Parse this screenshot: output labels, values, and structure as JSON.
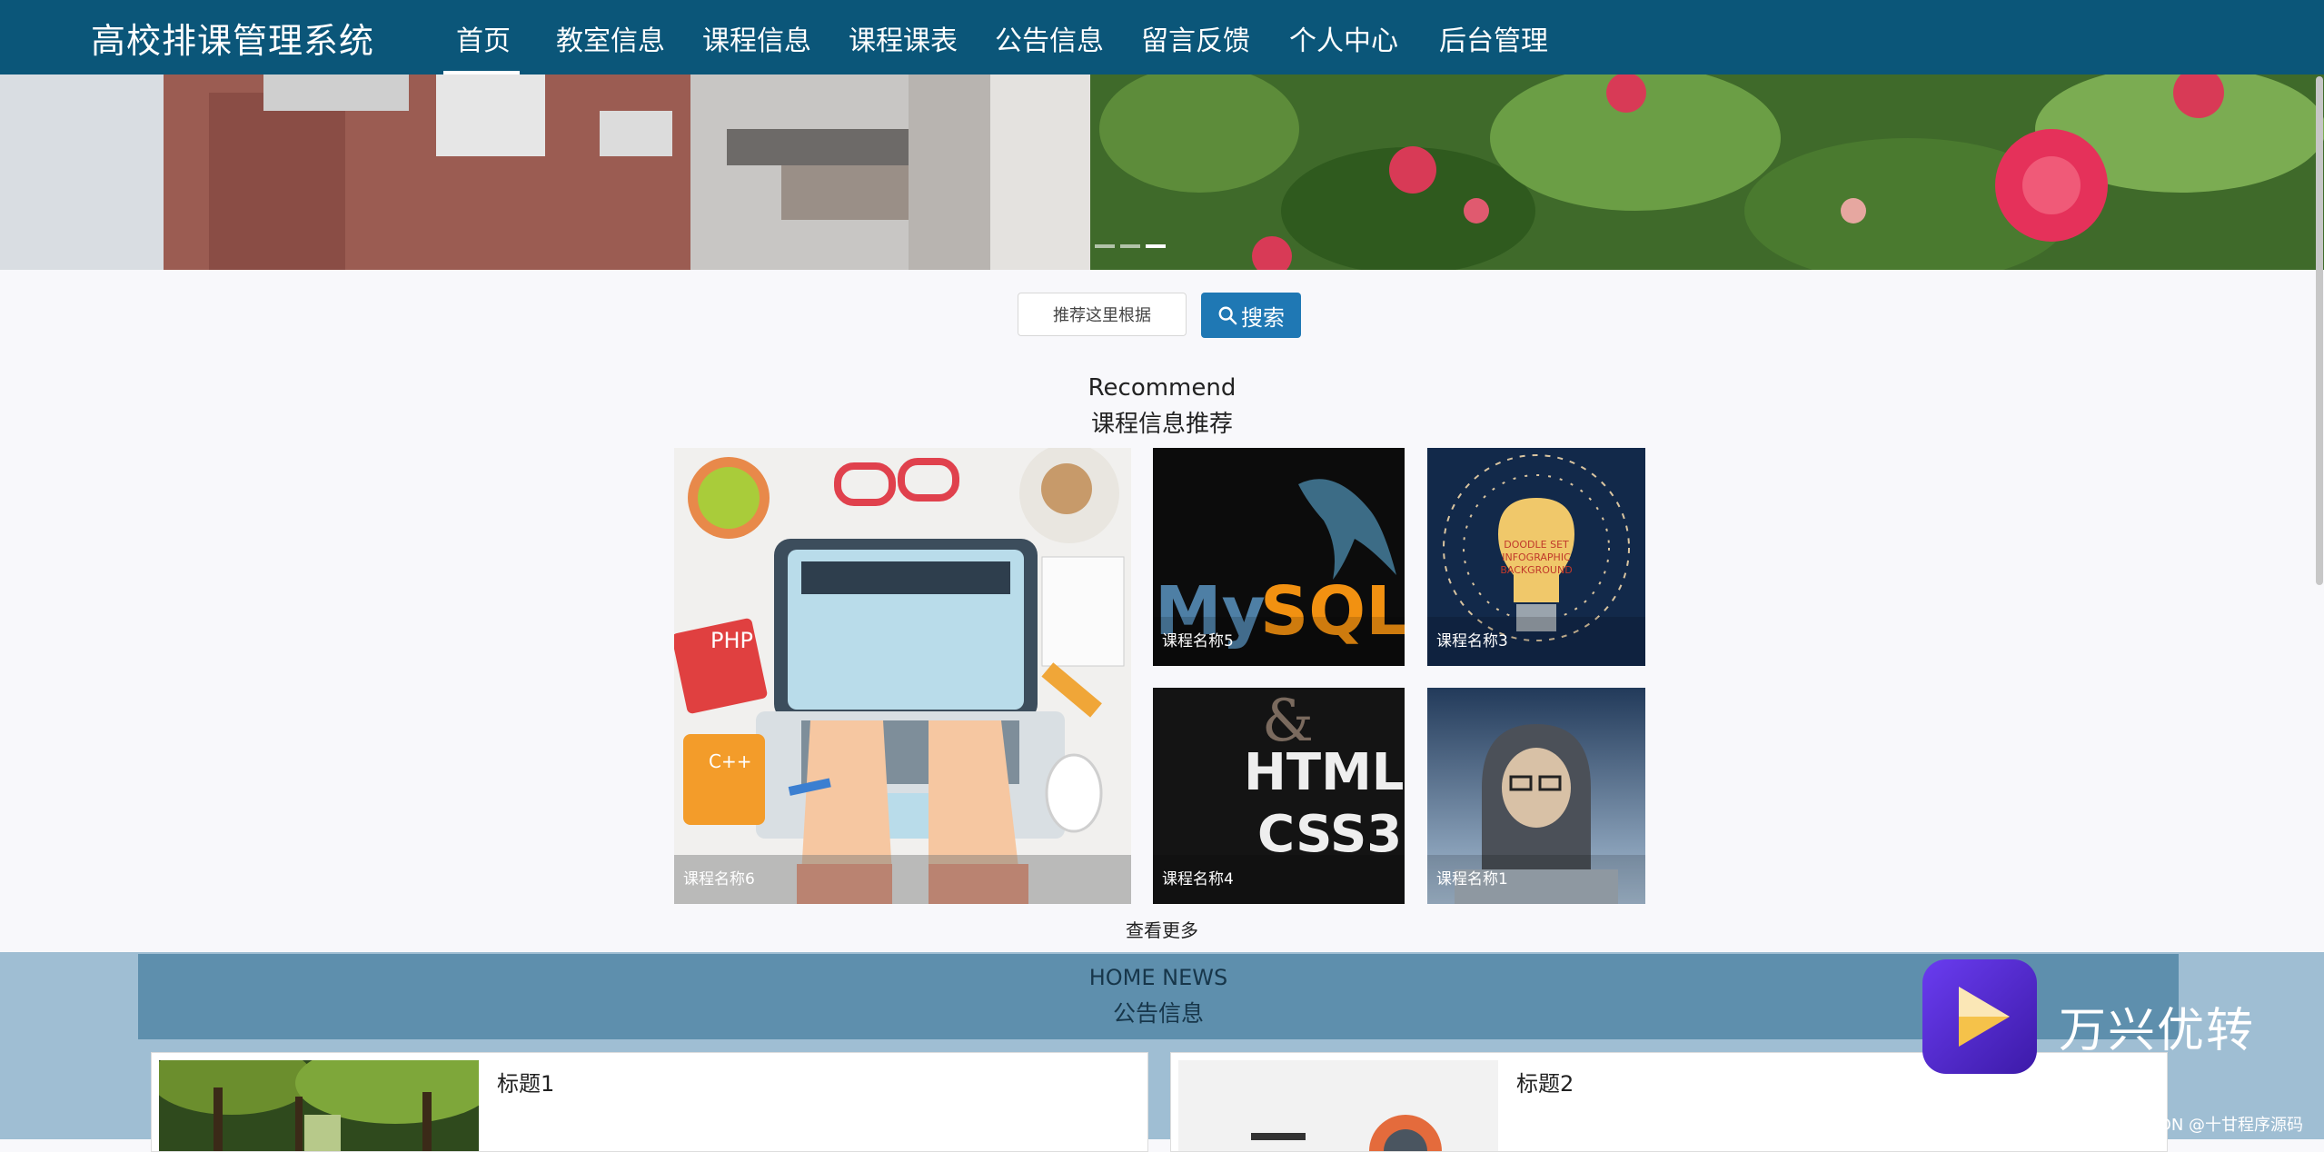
{
  "app": {
    "title": "高校排课管理系统"
  },
  "nav": {
    "items": [
      {
        "label": "首页",
        "active": true
      },
      {
        "label": "教室信息"
      },
      {
        "label": "课程信息"
      },
      {
        "label": "课程课表"
      },
      {
        "label": "公告信息"
      },
      {
        "label": "留言反馈"
      },
      {
        "label": "个人中心"
      },
      {
        "label": "后台管理"
      }
    ]
  },
  "search": {
    "value": "推荐这里根据",
    "button_label": "搜索",
    "icon": "search-icon"
  },
  "recommend": {
    "title_en": "Recommend",
    "title_cn": "课程信息推荐",
    "items": [
      {
        "label": "课程名称6",
        "image": "laptop-illustration"
      },
      {
        "label": "课程名称5",
        "image": "mysql-logo"
      },
      {
        "label": "课程名称3",
        "image": "lightbulb-doodle"
      },
      {
        "label": "课程名称4",
        "image": "html5-css3-book"
      },
      {
        "label": "课程名称1",
        "image": "hacker-photo"
      }
    ],
    "more_label": "查看更多"
  },
  "news": {
    "title_en": "HOME NEWS",
    "title_cn": "公告信息",
    "items": [
      {
        "title": "标题1"
      },
      {
        "title": "标题2"
      }
    ]
  },
  "watermark": {
    "brand": "万兴优转",
    "credit": "CSDN @十甘程序源码"
  },
  "colors": {
    "nav_bg": "#0b5679",
    "search_button": "#1f78b4",
    "news_header": "#5e8fad"
  }
}
